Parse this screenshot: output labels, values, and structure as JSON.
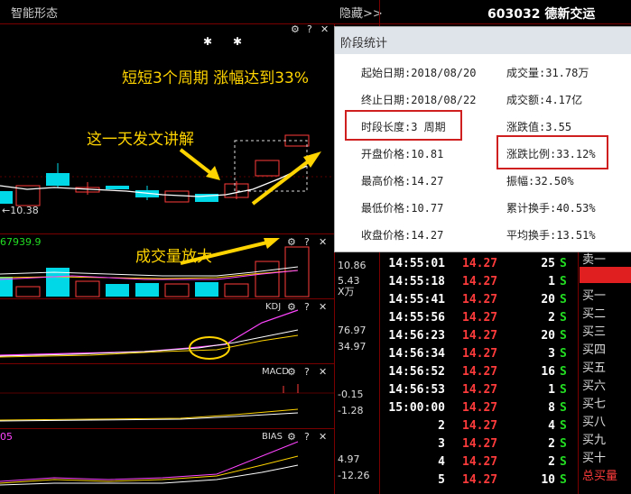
{
  "top": {
    "title": "智能形态",
    "hide": "隐藏>>",
    "stock": "603032 德新交运"
  },
  "annotations": {
    "headline": "短短3个周期 涨幅达到33%",
    "explain": "这一天发文讲解",
    "volume": "成交量放大",
    "low_price": "←10.38"
  },
  "volume_panel": {
    "value": "67939.9",
    "ticks": [
      "10.86",
      "5.43",
      "X万"
    ]
  },
  "kdj": {
    "label": "KDJ",
    "ticks": [
      "76.97",
      "34.97"
    ]
  },
  "macd": {
    "label": "MACD",
    "ticks": [
      "-0.15",
      "-1.28"
    ]
  },
  "bias": {
    "label": "BIAS",
    "ticks": [
      "4.97",
      "-12.26"
    ],
    "left_value": "05"
  },
  "stats": {
    "title": "阶段统计",
    "start": "起始日期:2018/08/20",
    "end": "终止日期:2018/08/22",
    "length": "时段长度:3 周期",
    "open": "开盘价格:10.81",
    "high": "最高价格:14.27",
    "low": "最低价格:10.77",
    "close": "收盘价格:14.27",
    "volume": "成交量:31.78万",
    "amount": "成交额:4.17亿",
    "change": "涨跌值:3.55",
    "change_pct": "涨跌比例:33.12%",
    "amplitude": "振幅:32.50%",
    "cum_turnover": "累计换手:40.53%",
    "avg_turnover": "平均换手:13.51%"
  },
  "trades": [
    {
      "time": "14:55:01",
      "price": "14.27",
      "vol": "25",
      "side": "S"
    },
    {
      "time": "14:55:18",
      "price": "14.27",
      "vol": "1",
      "side": "S"
    },
    {
      "time": "14:55:41",
      "price": "14.27",
      "vol": "20",
      "side": "S"
    },
    {
      "time": "14:55:56",
      "price": "14.27",
      "vol": "2",
      "side": "S"
    },
    {
      "time": "14:56:23",
      "price": "14.27",
      "vol": "20",
      "side": "S"
    },
    {
      "time": "14:56:34",
      "price": "14.27",
      "vol": "3",
      "side": "S"
    },
    {
      "time": "14:56:52",
      "price": "14.27",
      "vol": "16",
      "side": "S"
    },
    {
      "time": "14:56:53",
      "price": "14.27",
      "vol": "1",
      "side": "S"
    },
    {
      "time": "15:00:00",
      "price": "14.27",
      "vol": "8",
      "side": "S"
    },
    {
      "time": "2",
      "price": "14.27",
      "vol": "4",
      "side": "S"
    },
    {
      "time": "3",
      "price": "14.27",
      "vol": "2",
      "side": "S"
    },
    {
      "time": "4",
      "price": "14.27",
      "vol": "2",
      "side": "S"
    },
    {
      "time": "5",
      "price": "14.27",
      "vol": "10",
      "side": "S"
    }
  ],
  "orderbook": [
    "卖一",
    "",
    "买一",
    "买二",
    "买三",
    "买四",
    "买五",
    "买六",
    "买七",
    "买八",
    "买九",
    "买十",
    "总买量"
  ]
}
